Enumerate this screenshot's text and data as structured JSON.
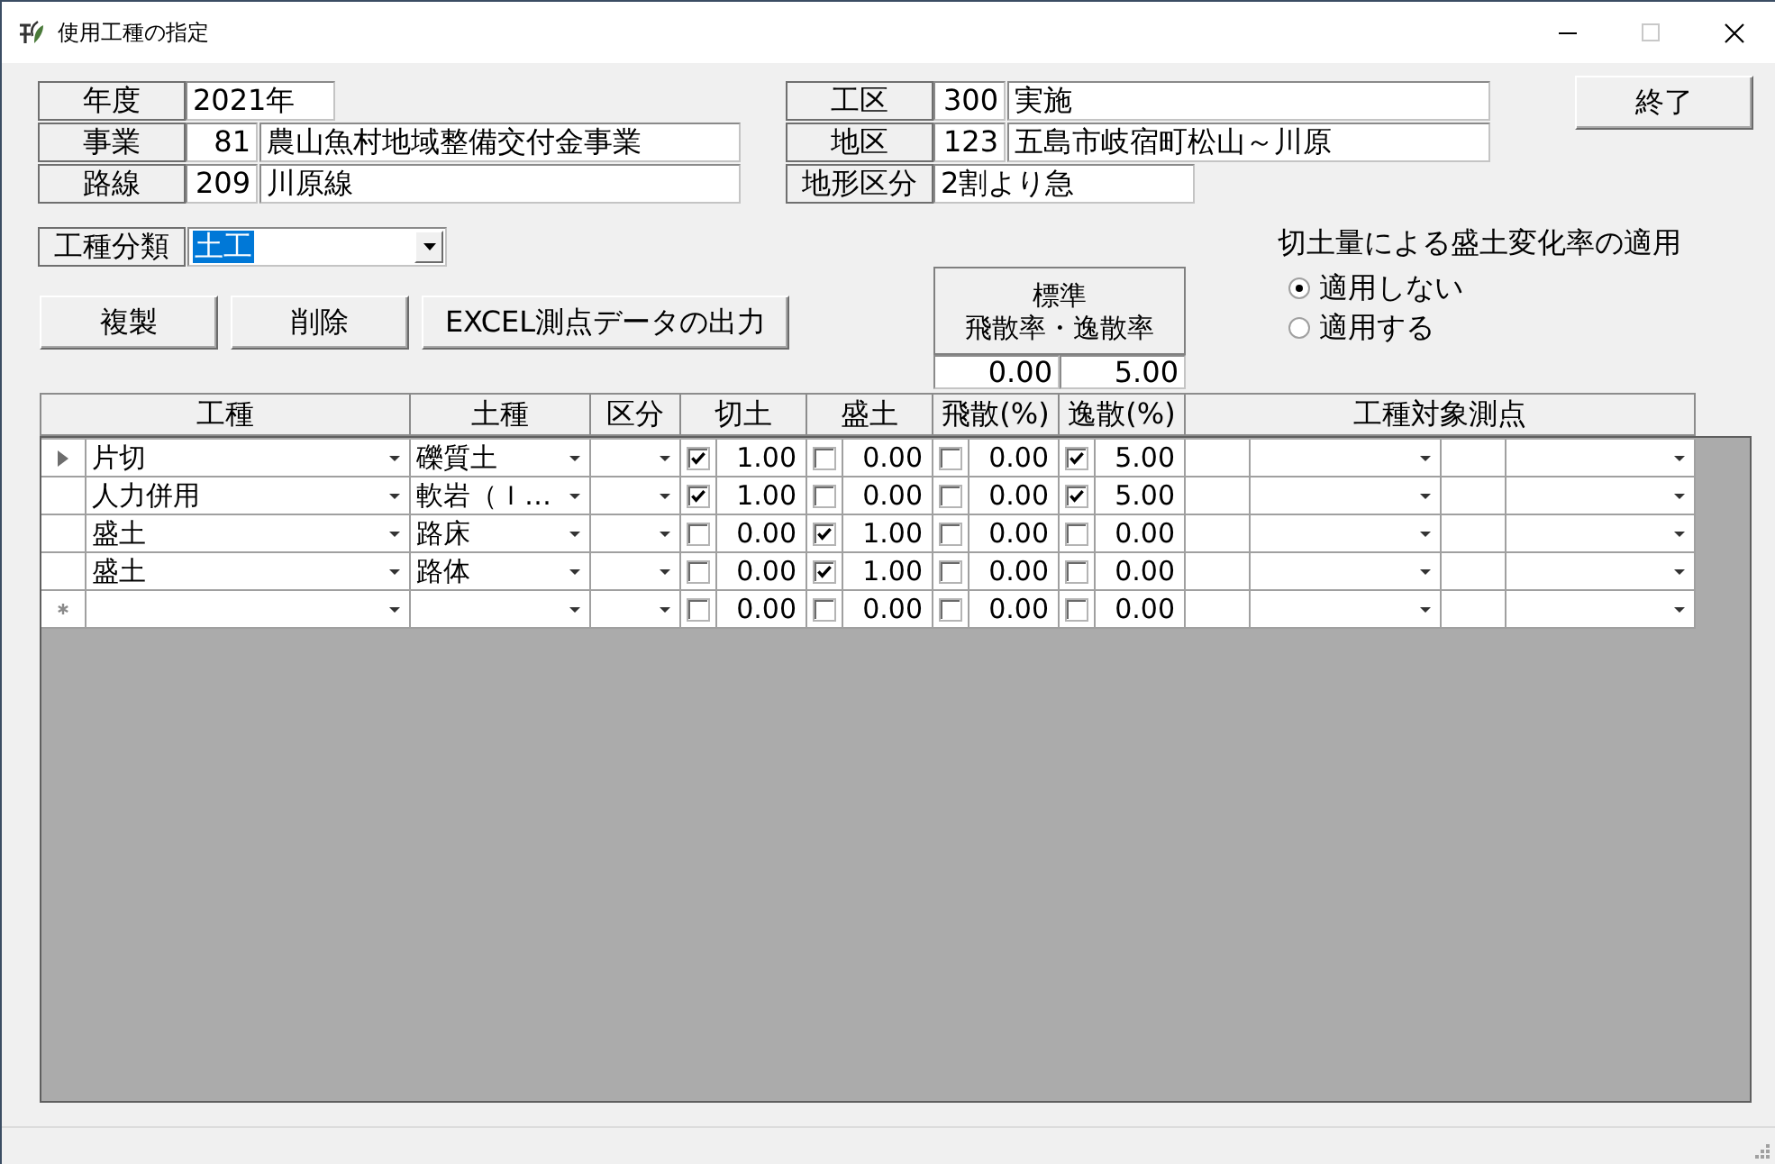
{
  "window": {
    "title": "使用工種の指定",
    "maximize_disabled": true
  },
  "info_left": [
    {
      "label": "年度",
      "value": "2021年"
    },
    {
      "label": "事業",
      "code": "81",
      "value": "農山魚村地域整備交付金事業"
    },
    {
      "label": "路線",
      "code": "209",
      "value": "川原線"
    }
  ],
  "info_right": [
    {
      "label": "工区",
      "code": "300",
      "value": "実施"
    },
    {
      "label": "地区",
      "code": "123",
      "value": "五島市岐宿町松山～川原"
    },
    {
      "label": "地形区分",
      "value": "2割より急"
    }
  ],
  "exit_button": "終了",
  "category": {
    "label": "工種分類",
    "value": "土工",
    "value_highlighted": true
  },
  "buttons": [
    "複製",
    "削除",
    "EXCEL測点データの出力"
  ],
  "standard_rates": {
    "title": [
      "標準",
      "飛散率・逸散率"
    ],
    "values": [
      "0.00",
      "5.00"
    ]
  },
  "fill_change_option": {
    "title": "切土量による盛土変化率の適用",
    "options": [
      {
        "label": "適用しない",
        "selected": true
      },
      {
        "label": "適用する",
        "selected": false
      }
    ]
  },
  "table": {
    "columns": [
      "工種",
      "土種",
      "区分",
      "切土",
      "盛土",
      "飛散(%)",
      "逸散(%)",
      "工種対象測点"
    ],
    "rows": [
      {
        "kind": "current",
        "work_type": "片切",
        "soil_type": "礫質土",
        "cut": {
          "checked": true,
          "value": "1.00"
        },
        "fill": {
          "checked": false,
          "value": "0.00"
        },
        "scatter": {
          "checked": false,
          "value": "0.00"
        },
        "loss": {
          "checked": true,
          "value": "5.00"
        }
      },
      {
        "kind": "record",
        "work_type": "人力併用",
        "soil_type": "軟岩（Ｉ…",
        "cut": {
          "checked": true,
          "value": "1.00"
        },
        "fill": {
          "checked": false,
          "value": "0.00"
        },
        "scatter": {
          "checked": false,
          "value": "0.00"
        },
        "loss": {
          "checked": true,
          "value": "5.00"
        }
      },
      {
        "kind": "record",
        "work_type": "盛土",
        "soil_type": "路床",
        "cut": {
          "checked": false,
          "value": "0.00"
        },
        "fill": {
          "checked": true,
          "value": "1.00"
        },
        "scatter": {
          "checked": false,
          "value": "0.00"
        },
        "loss": {
          "checked": false,
          "value": "0.00"
        }
      },
      {
        "kind": "record",
        "work_type": "盛土",
        "soil_type": "路体",
        "cut": {
          "checked": false,
          "value": "0.00"
        },
        "fill": {
          "checked": true,
          "value": "1.00"
        },
        "scatter": {
          "checked": false,
          "value": "0.00"
        },
        "loss": {
          "checked": false,
          "value": "0.00"
        }
      },
      {
        "kind": "new",
        "cut": {
          "checked": false,
          "value": "0.00"
        },
        "fill": {
          "checked": false,
          "value": "0.00"
        },
        "scatter": {
          "checked": false,
          "value": "0.00"
        },
        "loss": {
          "checked": false,
          "value": "0.00"
        }
      }
    ]
  }
}
